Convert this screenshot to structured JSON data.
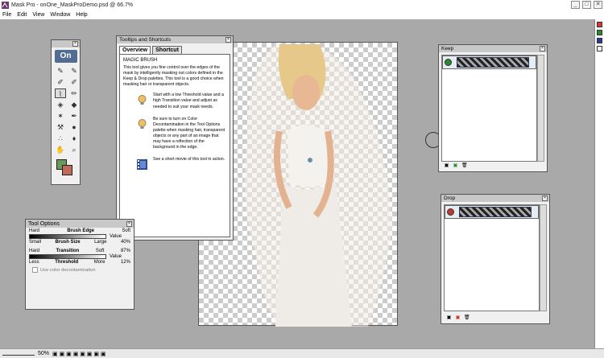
{
  "window": {
    "title": "Mask Pro - onOne_MaskProDemo.psd @ 66.7%",
    "minimize": "_",
    "maximize": "□",
    "close": "✕"
  },
  "menu": [
    "File",
    "Edit",
    "View",
    "Window",
    "Help"
  ],
  "status": {
    "zoom": "50%"
  },
  "tools": {
    "logo": "On"
  },
  "tooltips": {
    "title": "Tooltips and Shortcuts",
    "tabs": [
      "Overview",
      "Shortcut"
    ],
    "heading": "MAGIC BRUSH",
    "description": "This tool gives you fine control over the edges of the mask by intelligently masking out colors defined in the Keep & Drop palettes. This tool is a good choice when masking hair or transparent objects.",
    "tip1": "Start with a low Threshold value and a high Transition value and adjust as needed to suit your mask needs.",
    "tip2": "Be sure to turn on Color Decontamination in the Tool Options palette when masking hair, transparent objects or any part of an image that may have a reflection of the background in the edge.",
    "tip3": "See a short movie of this tool in action."
  },
  "tool_options": {
    "title": "Tool Options",
    "brush_edge": {
      "left": "Hard",
      "label": "Brush Edge",
      "right": "Soft",
      "value": "Value"
    },
    "brush_size": {
      "left": "Small",
      "label": "Brush Size",
      "right": "Large",
      "value": "40%"
    },
    "transition": {
      "left": "Hard",
      "label": "Transition",
      "right": "Soft",
      "value": "87%"
    },
    "threshold": {
      "left": "Less",
      "label": "Threshold",
      "right": "More",
      "value": "12%",
      "extra": "Value"
    },
    "decontam": "Use color decontamination"
  },
  "keep": {
    "title": "Keep"
  },
  "drop": {
    "title": "Drop"
  }
}
